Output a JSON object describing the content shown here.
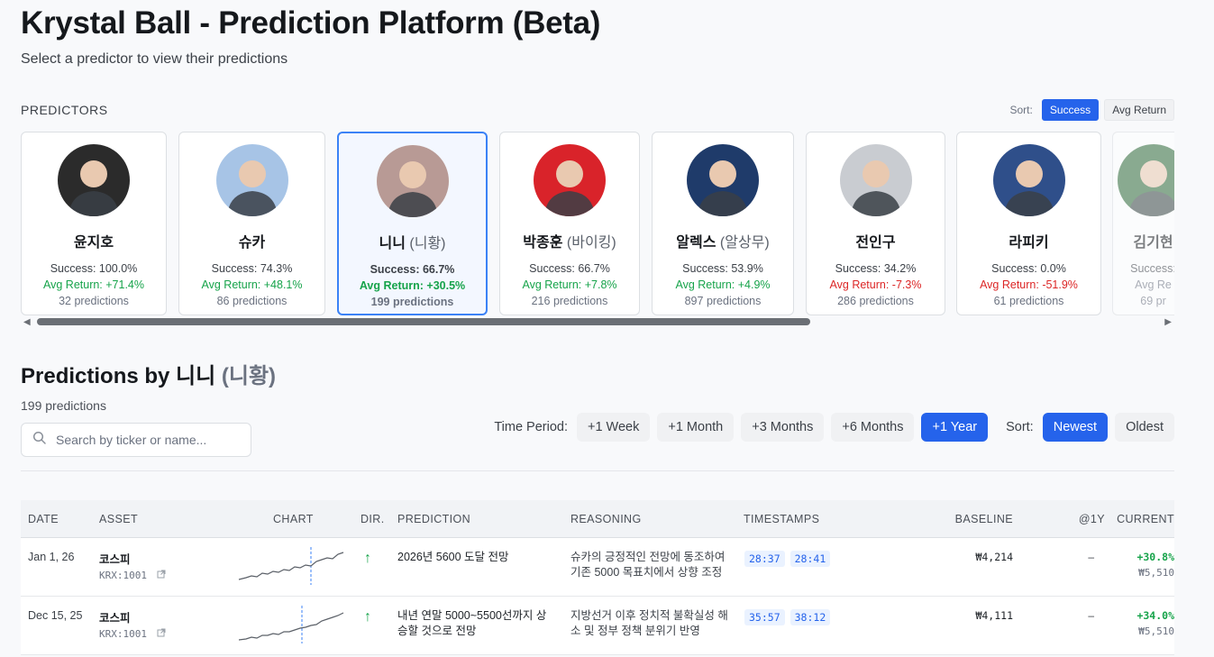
{
  "header": {
    "title": "Krystal Ball - Prediction Platform (Beta)",
    "subtitle": "Select a predictor to view their predictions"
  },
  "predictors_section": {
    "label": "PREDICTORS",
    "sort_label": "Sort:",
    "sort_options": [
      "Success",
      "Avg Return"
    ],
    "sort_selected": "Success"
  },
  "predictors": [
    {
      "name": "윤지호",
      "alias": "",
      "success": "Success: 100.0%",
      "avg_return": "Avg Return: +71.4%",
      "return_sign": "pos",
      "predictions": "32 predictions",
      "avatar_color": "#2b2b2b"
    },
    {
      "name": "슈카",
      "alias": "",
      "success": "Success: 74.3%",
      "avg_return": "Avg Return: +48.1%",
      "return_sign": "pos",
      "predictions": "86 predictions",
      "avatar_color": "#a7c4e6"
    },
    {
      "name": "니니",
      "alias": "(니황)",
      "success": "Success: 66.7%",
      "avg_return": "Avg Return: +30.5%",
      "return_sign": "pos",
      "predictions": "199 predictions",
      "avatar_color": "#b89a95"
    },
    {
      "name": "박종훈",
      "alias": "(바이킹)",
      "success": "Success: 66.7%",
      "avg_return": "Avg Return: +7.8%",
      "return_sign": "pos",
      "predictions": "216 predictions",
      "avatar_color": "#d9232a"
    },
    {
      "name": "알렉스",
      "alias": "(알상무)",
      "success": "Success: 53.9%",
      "avg_return": "Avg Return: +4.9%",
      "return_sign": "pos",
      "predictions": "897 predictions",
      "avatar_color": "#1f3b6a"
    },
    {
      "name": "전인구",
      "alias": "",
      "success": "Success: 34.2%",
      "avg_return": "Avg Return: -7.3%",
      "return_sign": "neg",
      "predictions": "286 predictions",
      "avatar_color": "#c9ccd1"
    },
    {
      "name": "라피키",
      "alias": "",
      "success": "Success: 0.0%",
      "avg_return": "Avg Return: -51.9%",
      "return_sign": "neg",
      "predictions": "61 predictions",
      "avatar_color": "#2f4f8a"
    },
    {
      "name": "김기현",
      "alias": "",
      "success": "Success:",
      "avg_return": "Avg Re",
      "return_sign": "muted",
      "predictions": "69 pr",
      "avatar_color": "#2f6b3a"
    }
  ],
  "selected_predictor_index": 2,
  "predictions_section": {
    "title_prefix": "Predictions by",
    "name": "니니",
    "alias": "(니황)",
    "count": "199 predictions",
    "search_placeholder": "Search by ticker or name...",
    "time_period_label": "Time Period:",
    "time_periods": [
      "+1 Week",
      "+1 Month",
      "+3 Months",
      "+6 Months",
      "+1 Year"
    ],
    "time_period_selected": "+1 Year",
    "sort_label": "Sort:",
    "sort_options": [
      "Newest",
      "Oldest"
    ],
    "sort_selected": "Newest"
  },
  "table": {
    "columns": [
      "DATE",
      "ASSET",
      "CHART",
      "DIR.",
      "PREDICTION",
      "REASONING",
      "TIMESTAMPS",
      "BASELINE",
      "@1Y",
      "CURRENT"
    ],
    "rows": [
      {
        "date": "Jan 1, 26",
        "asset_name": "코스피",
        "asset_code": "KRX:1001",
        "direction": "↑",
        "prediction": "2026년 5600 도달 전망",
        "reasoning": "슈카의 긍정적인 전망에 동조하여 기존 5000 목표치에서 상향 조정",
        "timestamps": [
          "28:37",
          "28:41"
        ],
        "baseline": "₩4,214",
        "at_1y": "–",
        "current_pct": "+30.8%",
        "current_val": "₩5,510"
      },
      {
        "date": "Dec 15, 25",
        "asset_name": "코스피",
        "asset_code": "KRX:1001",
        "direction": "↑",
        "prediction": "내년 연말 5000~5500선까지 상승할 것으로 전망",
        "reasoning": "지방선거 이후 정치적 불확실성 해소 및 정부 정책 분위기 반영",
        "timestamps": [
          "35:57",
          "38:12"
        ],
        "baseline": "₩4,111",
        "at_1y": "–",
        "current_pct": "+34.0%",
        "current_val": "₩5,510"
      }
    ]
  },
  "colors": {
    "accent": "#2563eb",
    "positive": "#16a34a",
    "negative": "#dc2626"
  }
}
